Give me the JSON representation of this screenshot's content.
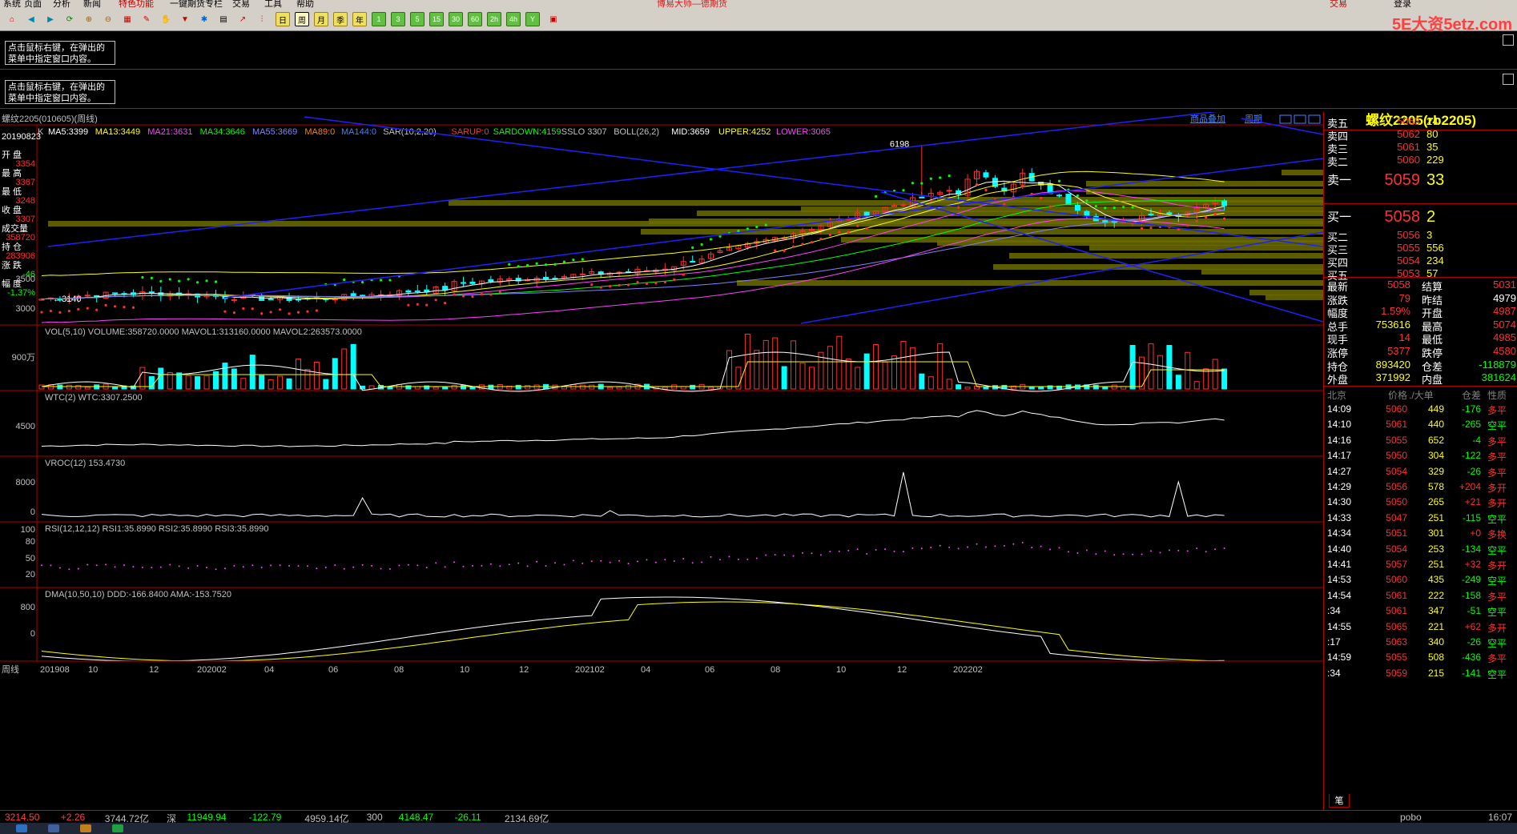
{
  "menu": {
    "items": [
      "系统",
      "页面",
      "分析",
      "新闻",
      "特色功能",
      "一键期货专栏",
      "交易",
      "工具",
      "帮助"
    ],
    "title": "博易大师—德期货",
    "trade_btn": "交易",
    "login_btn": "登录"
  },
  "watermark": "5E大资5etz.com",
  "toolbar": {
    "periods": [
      "日",
      "周",
      "月",
      "季",
      "年",
      "1",
      "3",
      "5",
      "15",
      "30",
      "60",
      "2h",
      "4h",
      "Y"
    ]
  },
  "info_msg": "点击鼠标右键，在弹出的菜单中指定窗口内容。",
  "chart_title": "螺纹2205(010605)(周线)",
  "indicator_line": {
    "k": "K",
    "items": [
      {
        "text": "MA5:3399",
        "color": "#ffffff"
      },
      {
        "text": "MA13:3449",
        "color": "#ffff00"
      },
      {
        "text": "MA21:3631",
        "color": "#ff40ff"
      },
      {
        "text": "MA34:3646",
        "color": "#00ff00"
      },
      {
        "text": "MA55:3669",
        "color": "#8080ff"
      },
      {
        "text": "MA89:0",
        "color": "#ff8000"
      },
      {
        "text": "MA144:0",
        "color": "#4080ff"
      },
      {
        "text": "SAR(10,2,20)",
        "color": "#c0c0c0"
      },
      {
        "text": "SARUP:0",
        "color": "#ff3030"
      },
      {
        "text": "SARDOWN:4159",
        "color": "#00ff00"
      },
      {
        "text": "SSLO 3307",
        "color": "#c0c0c0"
      },
      {
        "text": "BOLL(26,2)",
        "color": "#c0c0c0"
      },
      {
        "text": "MID:3659",
        "color": "#ffffff"
      },
      {
        "text": "UPPER:4252",
        "color": "#ffff00"
      },
      {
        "text": "LOWER:3065",
        "color": "#ff40ff"
      }
    ]
  },
  "top_links": [
    "商品叠加",
    "周期"
  ],
  "ohlc_panel": [
    {
      "label": "20190823",
      "value": ""
    },
    {
      "label": "开  盘",
      "value": "3354"
    },
    {
      "label": "最  高",
      "value": "3367"
    },
    {
      "label": "最  低",
      "value": "3248"
    },
    {
      "label": "收  盘",
      "value": "3307"
    },
    {
      "label": "成交量",
      "value": "358720"
    },
    {
      "label": "持  仓",
      "value": "283906"
    },
    {
      "label": "涨  跌",
      "value": "-46"
    },
    {
      "label": "幅  度",
      "value": "-1.37%"
    }
  ],
  "price_axis": [
    "3500",
    "3000"
  ],
  "annotations": {
    "high": "6198",
    "low": "3140"
  },
  "sub_panels": [
    {
      "name": "vol",
      "title": "VOL(5,10) VOLUME:358720.0000 MAVOL1:313160.0000 MAVOL2:263573.0000",
      "axis": [
        "900万"
      ]
    },
    {
      "name": "wtc",
      "title": "WTC(2) WTC:3307.2500",
      "axis": [
        "4500"
      ]
    },
    {
      "name": "vroc",
      "title": "VROC(12) 153.4730",
      "axis": [
        "8000",
        "0"
      ]
    },
    {
      "name": "rsi",
      "title": "RSI(12,12,12) RSI1:35.8990 RSI2:35.8990 RSI3:35.8990",
      "axis": [
        "100",
        "80",
        "50",
        "20"
      ]
    },
    {
      "name": "dma",
      "title": "DMA(10,50,10) DDD:-166.8400 AMA:-153.7520",
      "axis": [
        "800",
        "0"
      ]
    }
  ],
  "x_axis": [
    "周线",
    "201908",
    "10",
    "12",
    "202002",
    "04",
    "06",
    "08",
    "10",
    "12",
    "202102",
    "04",
    "06",
    "08",
    "10",
    "12",
    "202202"
  ],
  "quote": {
    "name": "螺纹2205(rb2205)",
    "asks": [
      {
        "label": "卖五",
        "price": "5063",
        "vol": "24"
      },
      {
        "label": "卖四",
        "price": "5062",
        "vol": "80"
      },
      {
        "label": "卖三",
        "price": "5061",
        "vol": "35"
      },
      {
        "label": "卖二",
        "price": "5060",
        "vol": "229"
      },
      {
        "label": "卖一",
        "price": "5059",
        "vol": "33"
      }
    ],
    "bids": [
      {
        "label": "买一",
        "price": "5058",
        "vol": "2"
      },
      {
        "label": "买二",
        "price": "5056",
        "vol": "3"
      },
      {
        "label": "买三",
        "price": "5055",
        "vol": "556"
      },
      {
        "label": "买四",
        "price": "5054",
        "vol": "234"
      },
      {
        "label": "买五",
        "price": "5053",
        "vol": "57"
      }
    ],
    "stats": [
      [
        "最新",
        "5058",
        "结算",
        "5031"
      ],
      [
        "涨跌",
        "79",
        "昨结",
        "4979"
      ],
      [
        "幅度",
        "1.59%",
        "开盘",
        "4987"
      ],
      [
        "总手",
        "753616",
        "最高",
        "5074"
      ],
      [
        "现手",
        "14",
        "最低",
        "4985"
      ],
      [
        "涨停",
        "5377",
        "跌停",
        "4580"
      ],
      [
        "持仓",
        "893420",
        "仓差",
        "-118879"
      ],
      [
        "外盘",
        "371992",
        "内盘",
        "381624"
      ]
    ],
    "ticks_header": [
      "北京",
      "价格",
      "./大单",
      "仓差",
      "性质"
    ],
    "ticks": [
      [
        "14:09",
        "5060",
        "449",
        "-176",
        "多平"
      ],
      [
        "14:10",
        "5061",
        "440",
        "-265",
        "空平"
      ],
      [
        "14:16",
        "5055",
        "652",
        "-4",
        "多平"
      ],
      [
        "14:17",
        "5050",
        "304",
        "-122",
        "多平"
      ],
      [
        "14:27",
        "5054",
        "329",
        "-26",
        "多平"
      ],
      [
        "14:29",
        "5056",
        "578",
        "+204",
        "多开"
      ],
      [
        "14:30",
        "5050",
        "265",
        "+21",
        "多开"
      ],
      [
        "14:33",
        "5047",
        "251",
        "-115",
        "空平"
      ],
      [
        "14:34",
        "5051",
        "301",
        "+0",
        "多换"
      ],
      [
        "14:40",
        "5054",
        "253",
        "-134",
        "空平"
      ],
      [
        "14:41",
        "5057",
        "251",
        "+32",
        "多开"
      ],
      [
        "14:53",
        "5060",
        "435",
        "-249",
        "空平"
      ],
      [
        "14:54",
        "5061",
        "222",
        "-158",
        "多平"
      ],
      [
        ":34",
        "5061",
        "347",
        "-51",
        "空平"
      ],
      [
        "14:55",
        "5065",
        "221",
        "+62",
        "多开"
      ],
      [
        ":17",
        "5063",
        "340",
        "-26",
        "空平"
      ],
      [
        "14:59",
        "5055",
        "508",
        "-436",
        "多平"
      ],
      [
        ":34",
        "5059",
        "215",
        "-141",
        "空平"
      ]
    ],
    "tab": "笔"
  },
  "status": [
    {
      "text": "3214.50",
      "color": "#ff4040"
    },
    {
      "text": "+2.26",
      "color": "#ff4040"
    },
    {
      "text": "3744.72亿",
      "color": "#c0c0c0"
    },
    {
      "text": "深",
      "color": "#c0c0c0"
    },
    {
      "text": "11949.94",
      "color": "#00ff00"
    },
    {
      "text": "-122.79",
      "color": "#00ff00"
    },
    {
      "text": "4959.14亿",
      "color": "#c0c0c0"
    },
    {
      "text": "300",
      "color": "#c0c0c0"
    },
    {
      "text": "4148.47",
      "color": "#00ff00"
    },
    {
      "text": "-26.11",
      "color": "#00ff00"
    },
    {
      "text": "2134.69亿",
      "color": "#c0c0c0"
    }
  ],
  "status_right": [
    "pobo",
    "16:07"
  ],
  "colors": {
    "up": "#ff3030",
    "down": "#00ffff",
    "grid": "#b00000",
    "axis_text": "#c0c0c0",
    "ma5": "#ffffff",
    "ma13": "#ffff00",
    "ma21": "#ff40ff",
    "ma34": "#00ff00",
    "ma55": "#8080ff",
    "trend": "#2020ff",
    "volume_profile": "#6b6b00"
  }
}
